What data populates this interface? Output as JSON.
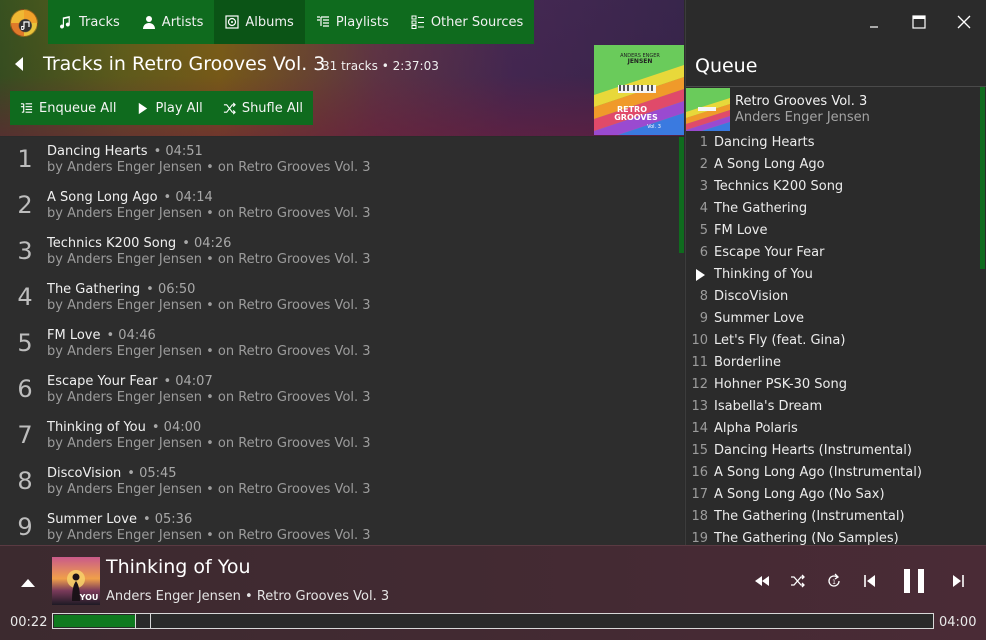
{
  "nav": {
    "items": [
      {
        "label": "Tracks",
        "icon": "music-note-icon"
      },
      {
        "label": "Artists",
        "icon": "person-icon"
      },
      {
        "label": "Albums",
        "icon": "disc-icon"
      },
      {
        "label": "Playlists",
        "icon": "playlist-icon"
      },
      {
        "label": "Other Sources",
        "icon": "sources-icon"
      }
    ],
    "active": "Albums"
  },
  "header": {
    "title": "Tracks in Retro Grooves Vol. 3",
    "meta": "31 tracks • 2:37:03"
  },
  "actions": {
    "enqueue_all": "Enqueue All",
    "play_all": "Play All",
    "shuffle_all": "Shufle All"
  },
  "album_art": {
    "line1": "ANDERS ENGER",
    "line2": "JENSEN",
    "title_line1": "RETRO",
    "title_line2": "GROOVES",
    "vol": "Vol. 3"
  },
  "tracks": [
    {
      "num": "1",
      "title": "Dancing Hearts",
      "duration": "• 04:51",
      "sub": "by Anders Enger Jensen • on Retro Grooves Vol. 3"
    },
    {
      "num": "2",
      "title": "A Song Long Ago",
      "duration": "• 04:14",
      "sub": "by Anders Enger Jensen • on Retro Grooves Vol. 3"
    },
    {
      "num": "3",
      "title": "Technics K200 Song",
      "duration": "• 04:26",
      "sub": "by Anders Enger Jensen • on Retro Grooves Vol. 3"
    },
    {
      "num": "4",
      "title": "The Gathering",
      "duration": "• 06:50",
      "sub": "by Anders Enger Jensen • on Retro Grooves Vol. 3"
    },
    {
      "num": "5",
      "title": "FM Love",
      "duration": "• 04:46",
      "sub": "by Anders Enger Jensen • on Retro Grooves Vol. 3"
    },
    {
      "num": "6",
      "title": "Escape Your Fear",
      "duration": "• 04:07",
      "sub": "by Anders Enger Jensen • on Retro Grooves Vol. 3"
    },
    {
      "num": "7",
      "title": "Thinking of You",
      "duration": "• 04:00",
      "sub": "by Anders Enger Jensen • on Retro Grooves Vol. 3"
    },
    {
      "num": "8",
      "title": "DiscoVision",
      "duration": "• 05:45",
      "sub": "by Anders Enger Jensen • on Retro Grooves Vol. 3"
    },
    {
      "num": "9",
      "title": "Summer Love",
      "duration": "• 05:36",
      "sub": "by Anders Enger Jensen • on Retro Grooves Vol. 3"
    }
  ],
  "queue": {
    "title": "Queue",
    "album_name": "Retro Grooves Vol. 3",
    "album_artist": "Anders Enger Jensen",
    "playing_index": 6,
    "items": [
      {
        "num": "1",
        "title": "Dancing Hearts"
      },
      {
        "num": "2",
        "title": "A Song Long Ago"
      },
      {
        "num": "3",
        "title": "Technics K200 Song"
      },
      {
        "num": "4",
        "title": "The Gathering"
      },
      {
        "num": "5",
        "title": "FM Love"
      },
      {
        "num": "6",
        "title": "Escape Your Fear"
      },
      {
        "num": "",
        "title": "Thinking of You"
      },
      {
        "num": "8",
        "title": "DiscoVision"
      },
      {
        "num": "9",
        "title": "Summer Love"
      },
      {
        "num": "10",
        "title": "Let's Fly (feat. Gina)"
      },
      {
        "num": "11",
        "title": "Borderline"
      },
      {
        "num": "12",
        "title": "Hohner PSK-30 Song"
      },
      {
        "num": "13",
        "title": "Isabella's Dream"
      },
      {
        "num": "14",
        "title": "Alpha Polaris"
      },
      {
        "num": "15",
        "title": "Dancing Hearts (Instrumental)"
      },
      {
        "num": "16",
        "title": "A Song Long Ago (Instrumental)"
      },
      {
        "num": "17",
        "title": "A Song Long Ago (No Sax)"
      },
      {
        "num": "18",
        "title": "The Gathering (Instrumental)"
      },
      {
        "num": "19",
        "title": "The Gathering (No Samples)"
      }
    ]
  },
  "player": {
    "title": "Thinking of You",
    "subtitle": "Anders Enger Jensen • Retro Grooves Vol. 3",
    "cover_text": "YOU",
    "time_current": "00:22",
    "time_total": "04:00",
    "progress_fraction": 0.092
  },
  "colors": {
    "accent": "#0f6b1e",
    "accent_active": "#0b5416",
    "player_bg": "#442a33"
  }
}
